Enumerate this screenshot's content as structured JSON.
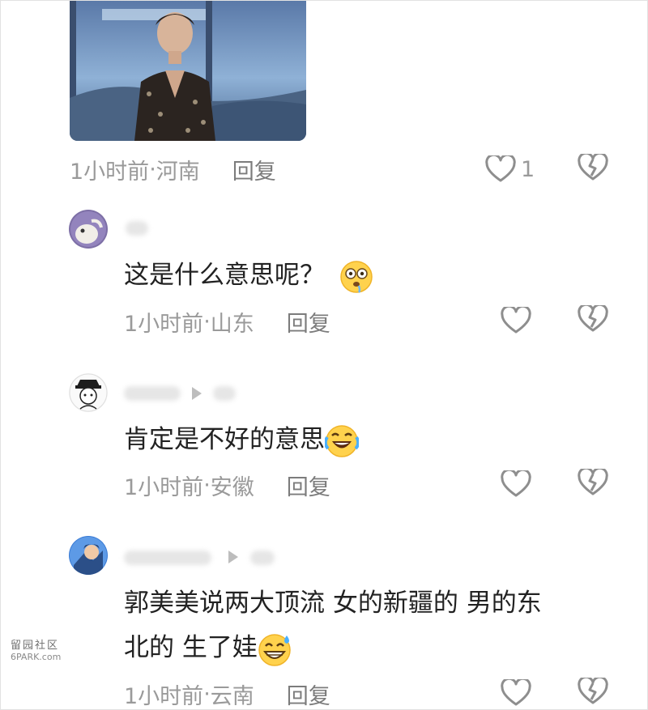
{
  "comments": [
    {
      "time": "1小时前",
      "location": "河南",
      "reply_label": "回复",
      "like_count": "1"
    },
    {
      "text": "这是什么意思呢？",
      "emoji": "drooling-face-emoji",
      "time": "1小时前",
      "location": "山东",
      "reply_label": "回复"
    },
    {
      "text": "肯定是不好的意思",
      "emoji": "laughing-crying-emoji",
      "time": "1小时前",
      "location": "安徽",
      "reply_label": "回复"
    },
    {
      "text_line1": "郭美美说两大顶流 女的新疆的 男的东",
      "text_line2": "北的 生了娃",
      "emoji": "sweat-grin-emoji",
      "time": "1小时前",
      "location": "云南",
      "reply_label": "回复"
    }
  ],
  "separator": " · ",
  "watermark": {
    "line1": "留园社区",
    "line2": "6PARK.com"
  },
  "colors": {
    "meta_text": "#9a9a9a",
    "body_text": "#222222",
    "icon_stroke": "#8e8e8e"
  }
}
